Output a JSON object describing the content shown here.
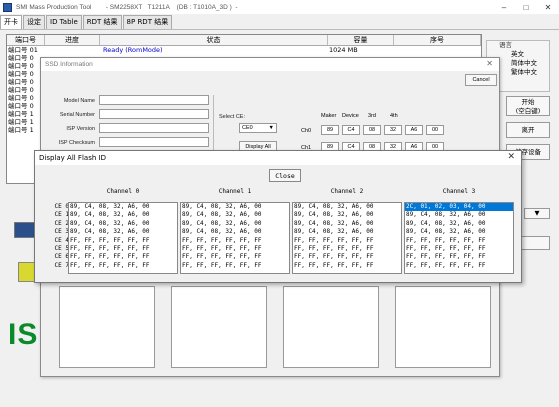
{
  "window": {
    "title": "SMI Mass Production Tool        - SM2258XT   T1211A    (DB : T1010A_3D )  -"
  },
  "main_tabs": [
    "开卡",
    "设定",
    "ID Table",
    "RDT 结果",
    "8P RDT 结果"
  ],
  "port_table": {
    "headers": [
      "端口号",
      "进度",
      "状态",
      "容量",
      "序号"
    ],
    "first_row": {
      "port": "端口号 01",
      "status": "Ready (RomMode)",
      "capacity": "1024 MB"
    },
    "other_rows": [
      "端口号 0",
      "端口号 0",
      "端口号 0",
      "端口号 0",
      "端口号 0",
      "端口号 0",
      "端口号 0",
      "端口号 1",
      "端口号 1",
      "端口号 1"
    ]
  },
  "side_panel": {
    "group_label": "语言",
    "options": [
      "英文",
      "简体中文",
      "繁体中文"
    ],
    "start_button": "开始\n(空白键)",
    "exit_button": "离开",
    "settings_button": "储存设备"
  },
  "left_bottom": {
    "big_text": "IS"
  },
  "ssd_dialog": {
    "title": "SSD Information",
    "cancel_label": "Cancel",
    "labels": [
      "Model Name",
      "Serial Number",
      "ISP Version",
      "ISP Checksum"
    ],
    "select_ce_label": "Select CE:",
    "select_ce_value": "CE0",
    "display_all_label": "Display All",
    "id_headers": [
      "Maker",
      "Device",
      "3rd",
      "4th"
    ],
    "rows": [
      {
        "label": "Ch0",
        "values": [
          "89",
          "C4",
          "08",
          "32",
          "A6",
          "00"
        ]
      },
      {
        "label": "Ch1",
        "values": [
          "89",
          "C4",
          "08",
          "32",
          "A6",
          "00"
        ]
      }
    ]
  },
  "flash_dialog": {
    "title": "Display All Flash ID",
    "close_label": "Close",
    "ce_labels": [
      "CE 0",
      "CE 1",
      "CE 2",
      "CE 3",
      "CE 4",
      "CE 5",
      "CE 6",
      "CE 7"
    ],
    "channels": [
      {
        "name": "Channel 0",
        "rows": [
          "89, C4, 08, 32, A6, 00",
          "89, C4, 08, 32, A6, 00",
          "89, C4, 08, 32, A6, 00",
          "89, C4, 08, 32, A6, 00",
          "FF, FF, FF, FF, FF, FF",
          "FF, FF, FF, FF, FF, FF",
          "FF, FF, FF, FF, FF, FF",
          "FF, FF, FF, FF, FF, FF"
        ]
      },
      {
        "name": "Channel 1",
        "rows": [
          "89, C4, 08, 32, A6, 00",
          "89, C4, 08, 32, A6, 00",
          "89, C4, 08, 32, A6, 00",
          "89, C4, 08, 32, A6, 00",
          "FF, FF, FF, FF, FF, FF",
          "FF, FF, FF, FF, FF, FF",
          "FF, FF, FF, FF, FF, FF",
          "FF, FF, FF, FF, FF, FF"
        ]
      },
      {
        "name": "Channel 2",
        "rows": [
          "89, C4, 08, 32, A6, 00",
          "89, C4, 08, 32, A6, 00",
          "89, C4, 08, 32, A6, 00",
          "89, C4, 08, 32, A6, 00",
          "FF, FF, FF, FF, FF, FF",
          "FF, FF, FF, FF, FF, FF",
          "FF, FF, FF, FF, FF, FF",
          "FF, FF, FF, FF, FF, FF"
        ]
      },
      {
        "name": "Channel 3",
        "rows": [
          "2C, 01, 02, 03, 04, 00",
          "89, C4, 08, 32, A6, 00",
          "89, C4, 08, 32, A6, 00",
          "89, C4, 08, 32, A6, 00",
          "FF, FF, FF, FF, FF, FF",
          "FF, FF, FF, FF, FF, FF",
          "FF, FF, FF, FF, FF, FF",
          "FF, FF, FF, FF, FF, FF"
        ],
        "selected_row": 0
      }
    ]
  },
  "colors": {
    "selection": "#0078d7",
    "status_blue": "#0000cc",
    "brand_green": "#0a8a2a"
  }
}
